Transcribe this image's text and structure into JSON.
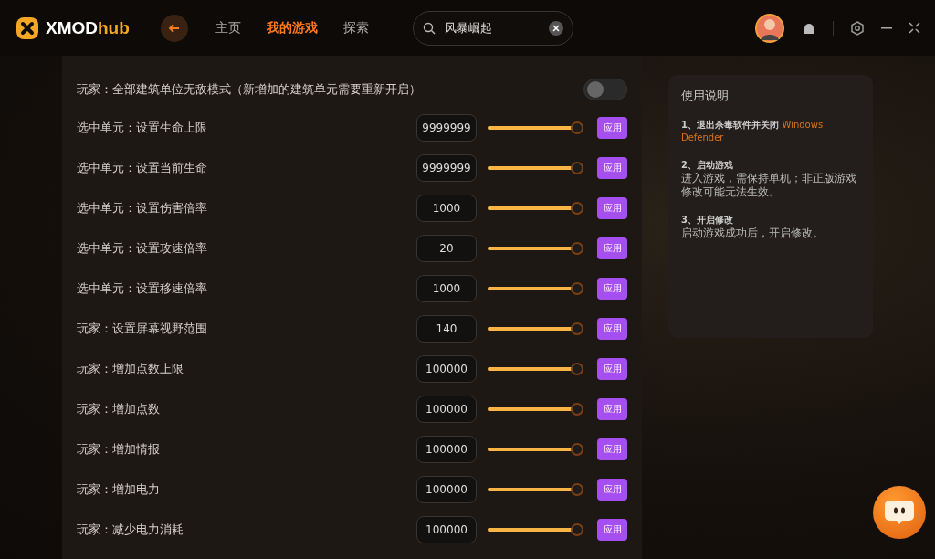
{
  "app": {
    "logo_text": "XMOD",
    "logo_accent": "hub"
  },
  "nav": [
    {
      "label": "主页",
      "selected": false
    },
    {
      "label": "我的游戏",
      "selected": true
    },
    {
      "label": "探索",
      "selected": false
    }
  ],
  "search": {
    "value": "风暴崛起"
  },
  "options": [
    {
      "kind": "toggle",
      "label": "玩家：全部建筑单位无敌模式（新增加的建筑单元需要重新开启）",
      "on": false
    },
    {
      "kind": "number",
      "label": "选中单元：设置生命上限",
      "value": "9999999",
      "level": 1,
      "button": "应用"
    },
    {
      "kind": "number",
      "label": "选中单元：设置当前生命",
      "value": "9999999",
      "level": 1,
      "button": "应用"
    },
    {
      "kind": "number",
      "label": "选中单元：设置伤害倍率",
      "value": "1000",
      "level": 1,
      "button": "应用"
    },
    {
      "kind": "number",
      "label": "选中单元：设置攻速倍率",
      "value": "20",
      "level": 1,
      "button": "应用"
    },
    {
      "kind": "number",
      "label": "选中单元：设置移速倍率",
      "value": "1000",
      "level": 1,
      "button": "应用"
    },
    {
      "kind": "number",
      "label": "玩家：设置屏幕视野范围",
      "value": "140",
      "level": 1,
      "button": "应用"
    },
    {
      "kind": "number",
      "label": "玩家：增加点数上限",
      "value": "100000",
      "level": 1,
      "button": "应用"
    },
    {
      "kind": "number",
      "label": "玩家：增加点数",
      "value": "100000",
      "level": 1,
      "button": "应用"
    },
    {
      "kind": "number",
      "label": "玩家：增加情报",
      "value": "100000",
      "level": 1,
      "button": "应用"
    },
    {
      "kind": "number",
      "label": "玩家：增加电力",
      "value": "100000",
      "level": 1,
      "button": "应用"
    },
    {
      "kind": "number",
      "label": "玩家：减少电力消耗",
      "value": "100000",
      "level": 1,
      "button": "应用"
    }
  ],
  "help": {
    "title": "使用说明",
    "steps": [
      {
        "heading": "1、退出杀毒软件并关闭",
        "highlight": "Windows Defender"
      },
      {
        "heading": "2、启动游戏",
        "body": "进入游戏，需保持单机；非正版游戏修改可能无法生效。"
      },
      {
        "heading": "3、开启修改",
        "body": "启动游戏成功后，开启修改。"
      }
    ]
  }
}
